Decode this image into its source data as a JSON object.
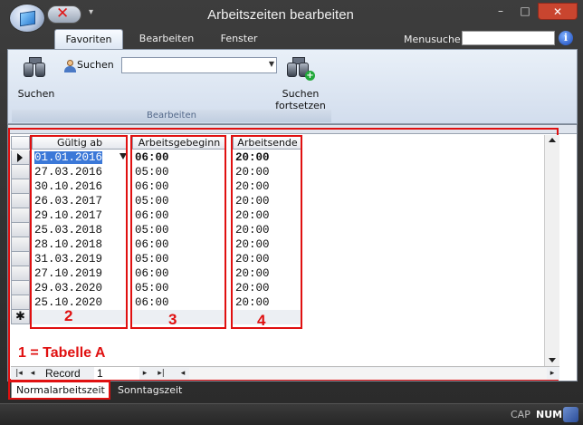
{
  "window": {
    "title": "Arbeitszeiten bearbeiten",
    "minimize": "–",
    "maximize": "□",
    "close": "✕"
  },
  "qat": {
    "delete_glyph": "✕",
    "more_glyph": "▾"
  },
  "ribbon": {
    "tabs": [
      "Favoriten",
      "Bearbeiten",
      "Fenster"
    ],
    "active_tab": "Favoriten",
    "menusuche_label": "Menusuche",
    "menusuche_value": "",
    "help_glyph": "i",
    "group_label": "Bearbeiten",
    "suchen_button": "Suchen",
    "suchen_small_label": "Suchen",
    "suchen_combo_value": "",
    "suchen_fortsetzen_line1": "Suchen",
    "suchen_fortsetzen_line2": "fortsetzen",
    "plus_glyph": "+"
  },
  "grid": {
    "columns": [
      "Gültig ab",
      "Arbeitsgebeginn",
      "Arbeitsende"
    ],
    "rows": [
      [
        "01.01.2016",
        "06:00",
        "20:00"
      ],
      [
        "27.03.2016",
        "05:00",
        "20:00"
      ],
      [
        "30.10.2016",
        "06:00",
        "20:00"
      ],
      [
        "26.03.2017",
        "05:00",
        "20:00"
      ],
      [
        "29.10.2017",
        "06:00",
        "20:00"
      ],
      [
        "25.03.2018",
        "05:00",
        "20:00"
      ],
      [
        "28.10.2018",
        "06:00",
        "20:00"
      ],
      [
        "31.03.2019",
        "05:00",
        "20:00"
      ],
      [
        "27.10.2019",
        "06:00",
        "20:00"
      ],
      [
        "29.03.2020",
        "05:00",
        "20:00"
      ],
      [
        "25.10.2020",
        "06:00",
        "20:00"
      ]
    ],
    "current_row": 0,
    "new_row_marker": "✱"
  },
  "annotations": {
    "legend": "1 = Tabelle A",
    "num2": "2",
    "num3": "3",
    "num4": "4",
    "color": "#e01010"
  },
  "navigator": {
    "label": "Record",
    "value": "1",
    "first": "|◂",
    "prev": "◂",
    "next": "▸",
    "last": "▸|",
    "scroll_left": "◂",
    "scroll_right": "▸"
  },
  "bottom_tabs": [
    "Normalarbeitszeit",
    "Sonntagszeit"
  ],
  "status": {
    "cap": "CAP",
    "num": "NUM"
  }
}
